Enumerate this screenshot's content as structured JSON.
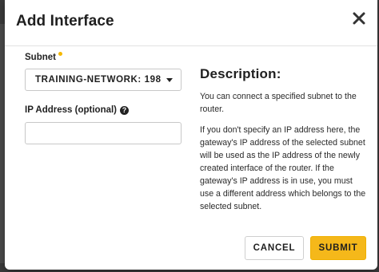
{
  "modal": {
    "title": "Add Interface",
    "close_icon": "close-icon"
  },
  "form": {
    "subnet_label": "Subnet",
    "subnet_required": true,
    "subnet_value": "TRAINING-NETWORK: 198....",
    "ip_label": "IP Address (optional)",
    "ip_help_icon": "question-circle-icon",
    "ip_value": "",
    "ip_placeholder": ""
  },
  "description": {
    "heading": "Description:",
    "paragraphs": [
      "You can connect a specified subnet to the router.",
      "If you don't specify an IP address here, the gateway's IP address of the selected subnet will be used as the IP address of the newly created interface of the router. If the gateway's IP address is in use, you must use a different address which belongs to the selected subnet."
    ]
  },
  "buttons": {
    "cancel": "CANCEL",
    "submit": "SUBMIT"
  },
  "colors": {
    "accent": "#f5b81a",
    "required_dot": "#f5b800"
  }
}
